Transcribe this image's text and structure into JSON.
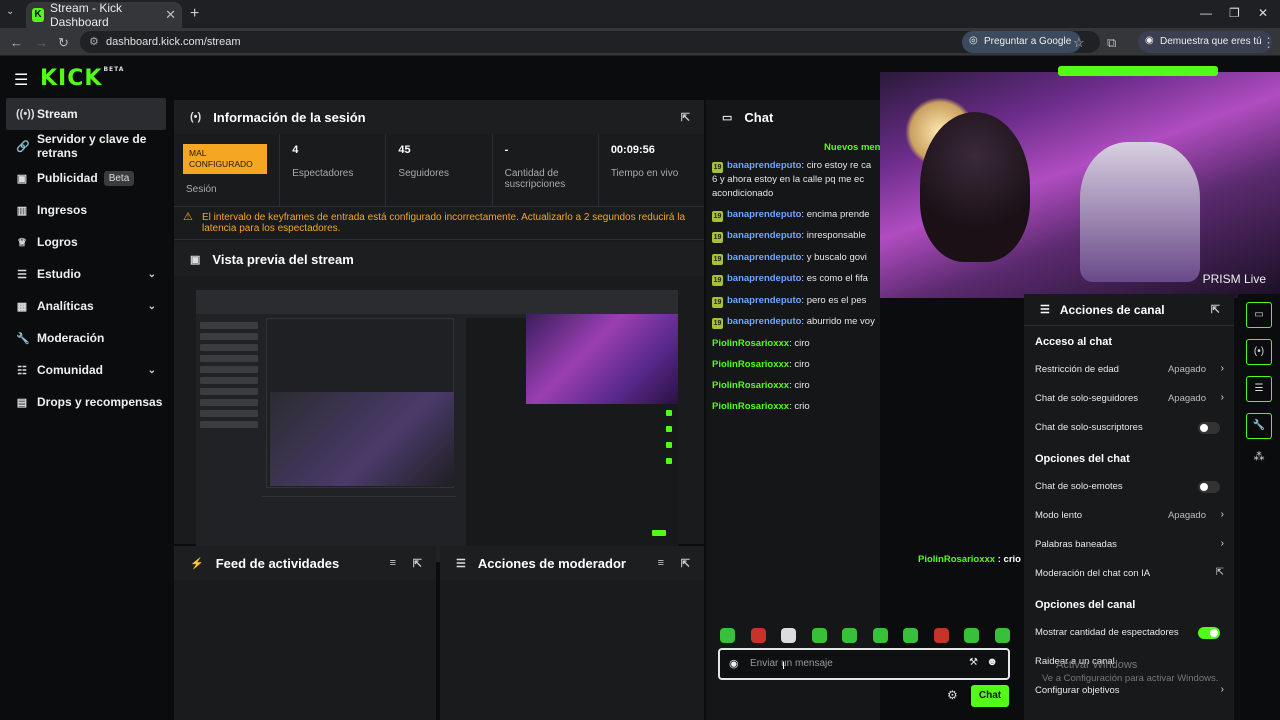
{
  "browser": {
    "tab_title": "Stream - Kick Dashboard",
    "url": "dashboard.kick.com/stream",
    "google_pill": "Preguntar a Google",
    "verify_pill": "Demuestra que eres tú"
  },
  "logo": {
    "text": "KICK",
    "tag": "BETA"
  },
  "sidebar": {
    "items": [
      {
        "label": "Stream",
        "icon": "broadcast-icon"
      },
      {
        "label": "Servidor y clave de retrans",
        "icon": "link-icon"
      },
      {
        "label": "Publicidad",
        "icon": "ad-icon",
        "badge": "Beta"
      },
      {
        "label": "Ingresos",
        "icon": "chart-icon"
      },
      {
        "label": "Logros",
        "icon": "trophy-icon"
      },
      {
        "label": "Estudio",
        "icon": "studio-icon"
      },
      {
        "label": "Analíticas",
        "icon": "analytics-icon"
      },
      {
        "label": "Moderación",
        "icon": "wrench-icon"
      },
      {
        "label": "Comunidad",
        "icon": "community-icon"
      },
      {
        "label": "Drops y recompensas",
        "icon": "gift-icon"
      }
    ]
  },
  "session": {
    "title": "Información de la sesión",
    "status_badge": "MAL CONFIGURADO",
    "status_label": "Sesión",
    "viewers": "4",
    "viewers_label": "Espectadores",
    "followers": "45",
    "followers_label": "Seguidores",
    "subs": "-",
    "subs_label": "Cantidad de suscripciones",
    "live_time": "00:09:56",
    "live_label": "Tiempo en vivo",
    "warning": "El intervalo de keyframes de entrada está configurado incorrectamente. Actualizarlo a 2 segundos reducirá la latencia para los espectadores."
  },
  "preview": {
    "title": "Vista previa del stream"
  },
  "activity": {
    "title": "Feed de actividades"
  },
  "moderator": {
    "title": "Acciones de moderador"
  },
  "chat": {
    "title": "Chat",
    "new_messages": "Nuevos men",
    "messages": [
      {
        "badge": "19",
        "user": "banaprendeputo",
        "text": ": ciro estoy re ca",
        "l2": "6 y ahora estoy en la calle pq me ec",
        "l3": "acondicionado"
      },
      {
        "badge": "19",
        "user": "banaprendeputo",
        "text": ": encima prende"
      },
      {
        "badge": "19",
        "user": "banaprendeputo",
        "text": ": inresponsable"
      },
      {
        "badge": "19",
        "user": "banaprendeputo",
        "text": ": y buscalo govi"
      },
      {
        "badge": "19",
        "user": "banaprendeputo",
        "text": ": es como el fifa"
      },
      {
        "badge": "19",
        "user": "banaprendeputo",
        "text": ": pero es el pes"
      },
      {
        "badge": "19",
        "user": "banaprendeputo",
        "text": ": aburrido me voy"
      },
      {
        "user": "PiolinRosarioxxx",
        "text": ": ciro"
      },
      {
        "user": "PiolinRosarioxxx",
        "text": ": ciro"
      },
      {
        "user": "PiolinRosarioxxx",
        "text": ": ciro"
      },
      {
        "user": "PiolinRosarioxxx",
        "text": ": crio"
      }
    ],
    "float_user": "PiolinRosarioxxx",
    "float_text": " : crio",
    "input_placeholder": "Enviar un mensaje",
    "send_label": "Chat"
  },
  "camera": {
    "watermark": "PRISM Live"
  },
  "channel_actions": {
    "title": "Acciones de canal",
    "sec_chat_access": "Acceso al chat",
    "age": "Restricción de edad",
    "age_val": "Apagado",
    "followers_only": "Chat de solo-seguidores",
    "followers_val": "Apagado",
    "subs_only": "Chat de solo-suscriptores",
    "sec_chat_opts": "Opciones del chat",
    "emotes_only": "Chat de solo-emotes",
    "slow": "Modo lento",
    "slow_val": "Apagado",
    "banned": "Palabras baneadas",
    "ai_mod": "Moderación del chat con IA",
    "sec_channel_opts": "Opciones del canal",
    "show_viewers": "Mostrar cantidad de espectadores",
    "raid": "Raidear a un canal",
    "goals": "Configurar objetivos"
  },
  "windows": {
    "line1": "Activar Windows",
    "line2": "Ve a Configuración para activar Windows."
  }
}
